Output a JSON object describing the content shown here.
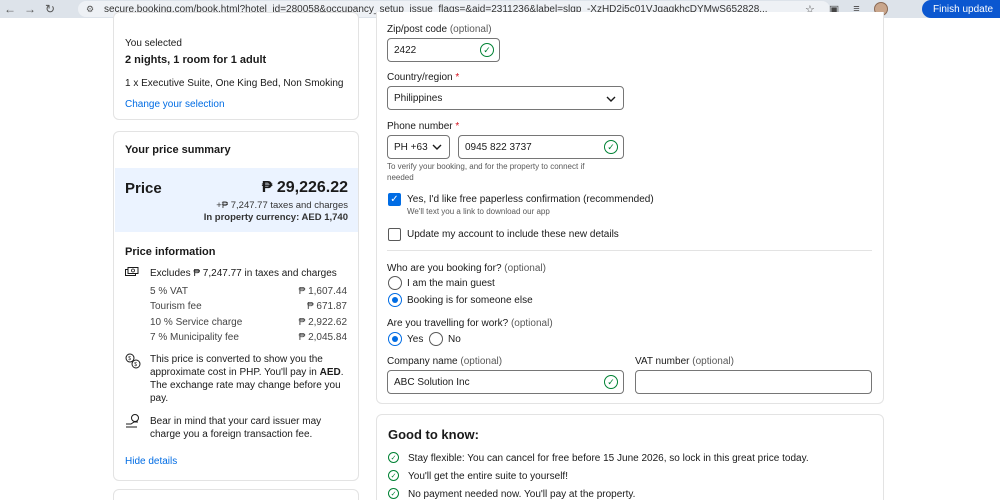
{
  "browser": {
    "url": "secure.booking.com/book.html?hotel_id=280058&occupancy_setup_issue_flags=&aid=2311236&label=slgp_-XzHD2j5c01VJgaqkhcDYMwS652828...",
    "finish_update": "Finish update"
  },
  "selection": {
    "you_selected": "You selected",
    "nights_rooms": "2 nights, 1 room for 1 adult",
    "room": "1 x Executive Suite, One King Bed, Non Smoking",
    "change": "Change your selection"
  },
  "price_summary": {
    "title": "Your price summary",
    "price_label": "Price",
    "price_value": "₱ 29,226.22",
    "taxes_line": "+₱ 7,247.77 taxes and charges",
    "property_currency": "In property currency: AED 1,740",
    "info_title": "Price information",
    "excludes": "Excludes ₱ 7,247.77 in taxes and charges",
    "items": [
      {
        "label": "5 % VAT",
        "value": "₱ 1,607.44"
      },
      {
        "label": "Tourism fee",
        "value": "₱ 671.87"
      },
      {
        "label": "10 % Service charge",
        "value": "₱ 2,922.62"
      },
      {
        "label": "7 % Municipality fee",
        "value": "₱ 2,045.84"
      }
    ],
    "converted_1": "This price is converted to show you the",
    "converted_2_pre": "approximate cost in PHP. You'll pay in ",
    "converted_2_bold": "AED",
    "converted_2_post": ".",
    "converted_3": "The exchange rate may change before you",
    "converted_4": "pay.",
    "card_issuer_1": "Bear in mind that your card issuer may",
    "card_issuer_2": "charge you a foreign transaction fee.",
    "hide_details": "Hide details"
  },
  "form": {
    "zip_label": "Zip/post code",
    "zip_optional": "(optional)",
    "zip_value": "2422",
    "country_label": "Country/region",
    "country_req": "*",
    "country_value": "Philippines",
    "phone_label": "Phone number",
    "phone_req": "*",
    "phone_code": "PH +63",
    "phone_value": "0945 822 3737",
    "phone_hint_1": "To verify your booking, and for the property to connect if",
    "phone_hint_2": "needed",
    "paperless_label": "Yes, I'd like free paperless confirmation (recommended)",
    "paperless_hint": "We'll text you a link to download our app",
    "update_account": "Update my account to include these new details",
    "booking_for_label": "Who are you booking for?",
    "booking_for_optional": "(optional)",
    "main_guest": "I am the main guest",
    "someone_else": "Booking is for someone else",
    "work_label": "Are you travelling for work?",
    "work_optional": "(optional)",
    "yes": "Yes",
    "no": "No",
    "company_label": "Company name",
    "company_optional": "(optional)",
    "company_value": "ABC Solution Inc",
    "vat_label": "VAT number",
    "vat_optional": "(optional)",
    "vat_value": ""
  },
  "good_to_know": {
    "title": "Good to know:",
    "items": [
      "Stay flexible: You can cancel for free before 15 June 2026, so lock in this great price today.",
      "You'll get the entire suite to yourself!",
      "No payment needed now. You'll pay at the property."
    ]
  },
  "colors": {
    "link": "#006ce4",
    "success": "#008234",
    "banner": "#ebf3ff",
    "required": "#d4111e"
  }
}
